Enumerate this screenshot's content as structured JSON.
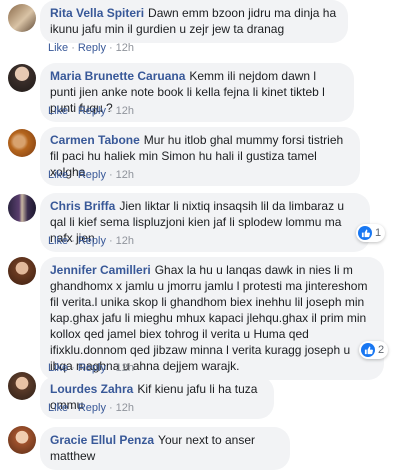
{
  "comments": [
    {
      "author": "Rita Vella Spiteri",
      "text": "Dawn emm bzoon jidru ma dinja ha ikunu jafu min il gurdien u zejr jew ta dranag",
      "like": "Like",
      "reply": "Reply",
      "time": "12h"
    },
    {
      "author": "Maria Brunette Caruana",
      "text": "Kemm ili nejdom dawn l punti jien anke note book li kella fejna li kinet tikteb l punti fuqu ?",
      "like": "Like",
      "reply": "Reply",
      "time": "12h"
    },
    {
      "author": "Carmen Tabone",
      "text": "Mur hu itlob ghal mummy forsi tistrieh fil paci hu haliek min Simon hu hali il gustiza tamel xolgha",
      "like": "Like",
      "reply": "Reply",
      "time": "12h"
    },
    {
      "author": "Chris Briffa",
      "text": "Jien liktar li nixtiq insaqsih lil da limbaraz u qal li kief sema lispluzjoni kien jaf li splodew lommu ma nafx jien",
      "like": "Like",
      "reply": "Reply",
      "time": "12h",
      "reaction_count": "1"
    },
    {
      "author": "Jennifer Camilleri",
      "text": "Ghax la hu u lanqas dawk in nies li m ghandhomx x jamlu u jmorru jamlu l protesti ma jintereshom fil verita.l unika skop li ghandhom biex inehhu lil joseph min kap.ghax jafu li mieghu mhux kapaci jlehqu.ghax il prim min kollox qed jamel biex tohrog il verita u Huma qed ifixklu.donnom qed jibzaw minna l verita kuragg joseph u ibqa maghna u ahna dejjem warajk.",
      "like": "Like",
      "reply": "Reply",
      "time": "12h",
      "reaction_count": "2"
    },
    {
      "author": "Lourdes Zahra",
      "text": "Kif kienu jafu li ha tuza ommu",
      "like": "Like",
      "reply": "Reply",
      "time": "12h"
    },
    {
      "author": "Gracie Ellul Penza",
      "text": "Your next to anser matthew"
    }
  ],
  "colors": {
    "link": "#385898",
    "bubble": "#f2f3f5",
    "like_blue": "#1877f2"
  },
  "icons": {
    "reaction": "thumbs-up-icon"
  }
}
